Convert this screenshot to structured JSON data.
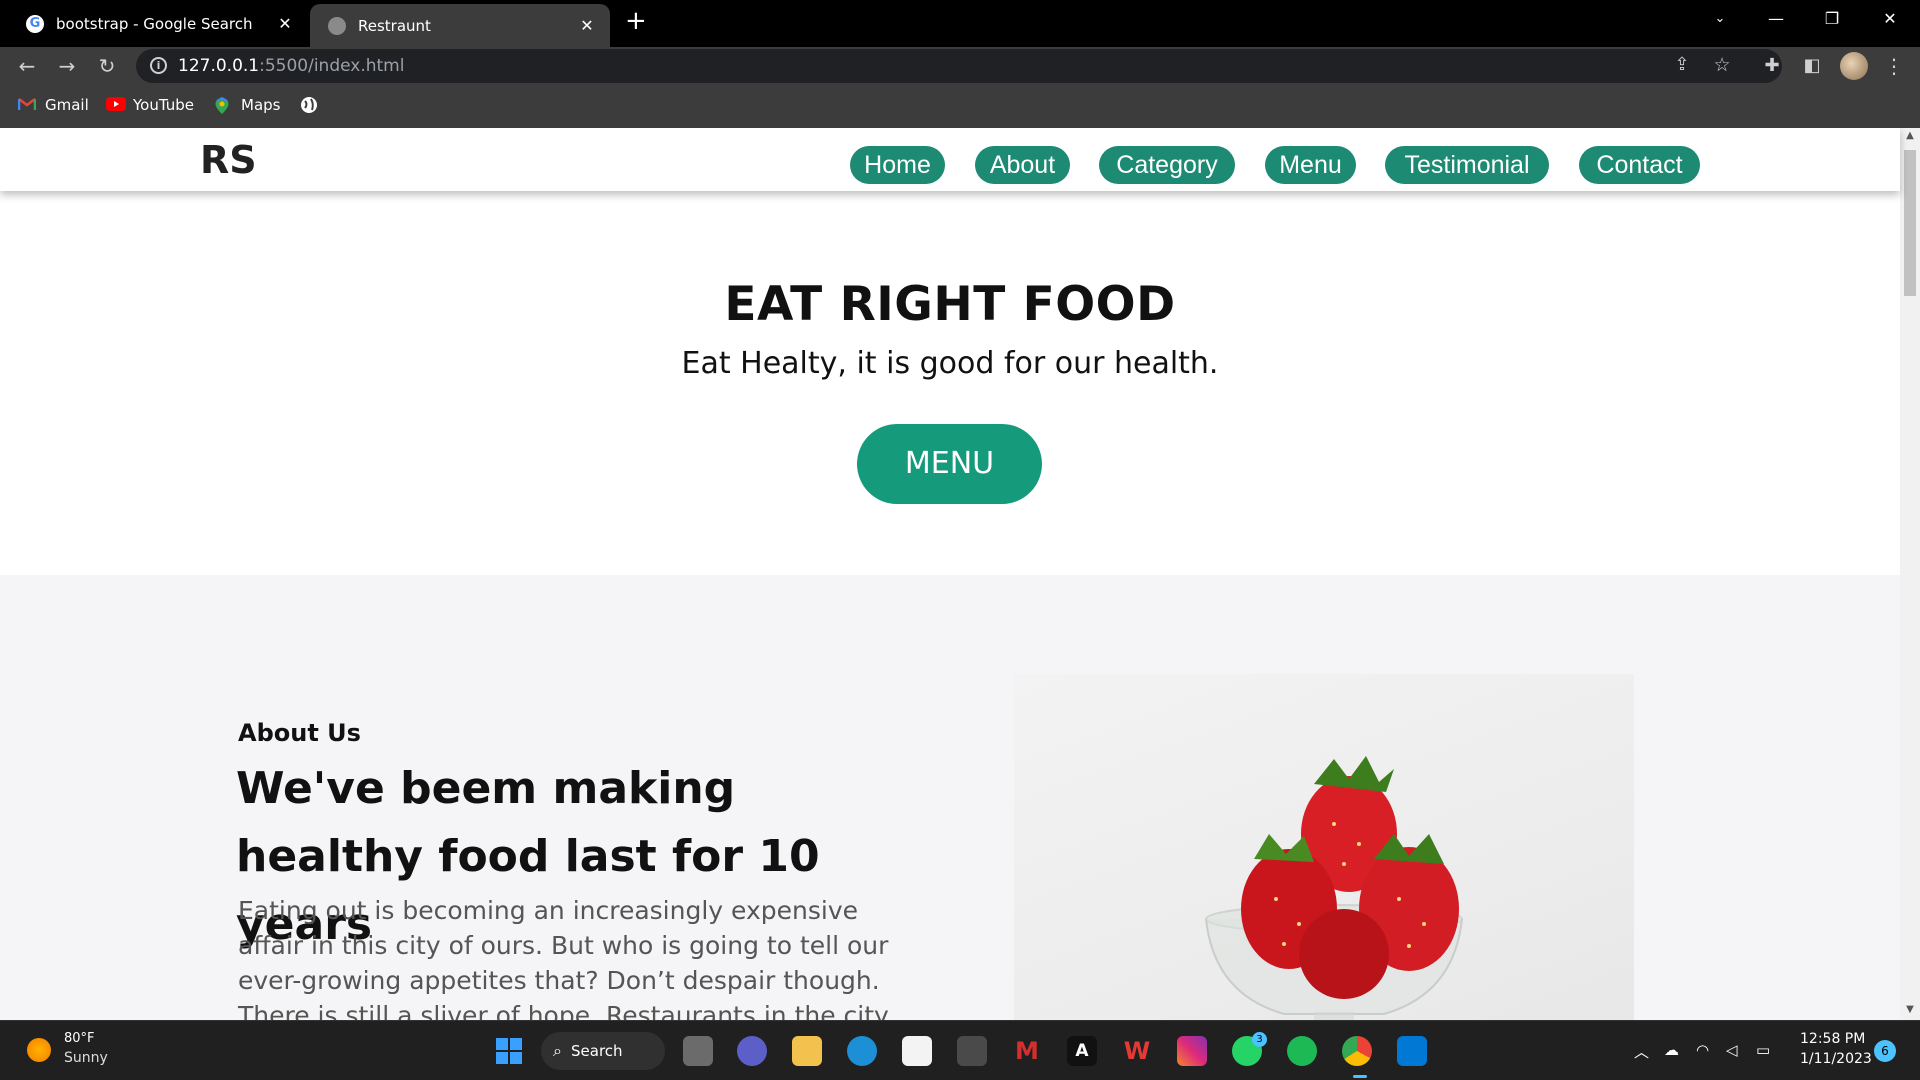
{
  "browser": {
    "tabs": [
      {
        "title": "bootstrap - Google Search",
        "favicon": "google-icon"
      },
      {
        "title": "Restraunt",
        "favicon": "globe-icon"
      }
    ],
    "url_host": "127.0.0.1",
    "url_rest": ":5500/index.html",
    "bookmarks": [
      {
        "label": "Gmail",
        "icon": "gmail-icon"
      },
      {
        "label": "YouTube",
        "icon": "youtube-icon"
      },
      {
        "label": "Maps",
        "icon": "maps-icon"
      }
    ]
  },
  "site": {
    "brand": "RS",
    "nav": [
      "Home",
      "About",
      "Category",
      "Menu",
      "Testimonial",
      "Contact"
    ],
    "accent": "#1d8a73",
    "hero": {
      "title": "EAT RIGHT FOOD",
      "subtitle": "Eat Healty, it is good for our health.",
      "button": "MENU"
    },
    "about": {
      "eyebrow": "About Us",
      "heading": "We've beem making healthy food last for 10 years",
      "body": "Eating out is becoming an increasingly expensive affair in this city of ours. But who is going to tell our ever-growing appetites that? Don’t despair though. There is still a sliver of hope. Restaurants in the city are looking"
    }
  },
  "taskbar": {
    "weather_temp": "80°F",
    "weather_desc": "Sunny",
    "search_label": "Search",
    "time": "12:58 PM",
    "date": "1/11/2023",
    "notification_count": "6",
    "whatsapp_badge": "3"
  }
}
